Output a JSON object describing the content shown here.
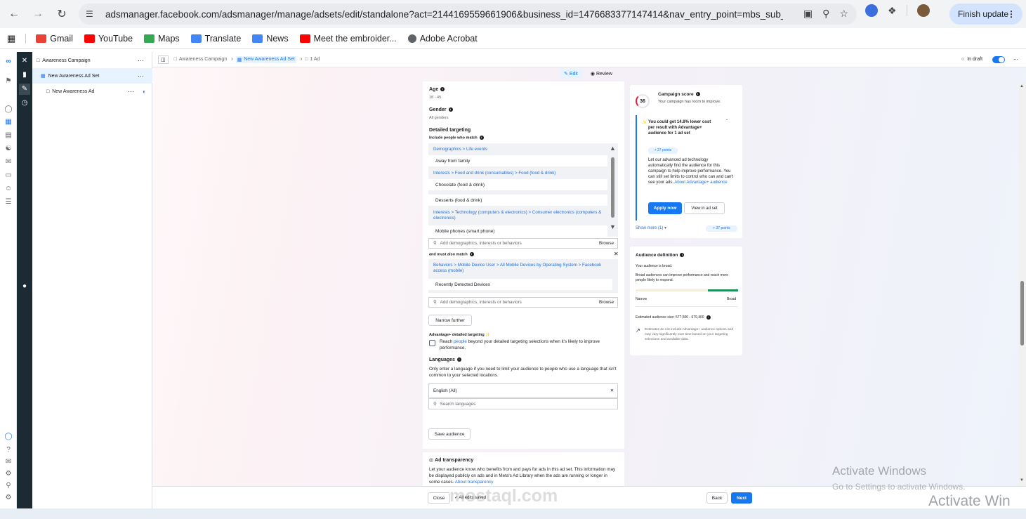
{
  "browser": {
    "url": "adsmanager.facebook.com/adsmanager/manage/adsets/edit/standalone?act=2144169559661906&business_id=1476683377147414&nav_entry_point=mbs_sub_n...",
    "finish_update": "Finish update"
  },
  "bookmarks": [
    {
      "label": "Gmail",
      "icon": "gmail-icon",
      "color": "#ea4335"
    },
    {
      "label": "YouTube",
      "icon": "youtube-icon",
      "color": "#ff0000"
    },
    {
      "label": "Maps",
      "icon": "maps-icon",
      "color": "#34a853"
    },
    {
      "label": "Translate",
      "icon": "translate-icon",
      "color": "#4285f4"
    },
    {
      "label": "News",
      "icon": "news-icon",
      "color": "#4285f4"
    },
    {
      "label": "Meet the embroider...",
      "icon": "youtube-icon",
      "color": "#ff0000"
    },
    {
      "label": "Adobe Acrobat",
      "icon": "globe-icon",
      "color": "#5f6368"
    }
  ],
  "tree": {
    "campaign": "Awareness Campaign",
    "adset": "New Awareness Ad Set",
    "ad": "New Awareness Ad"
  },
  "breadcrumb": {
    "campaign": "Awareness Campaign",
    "adset": "New Awareness Ad Set",
    "ad": "1 Ad"
  },
  "status": {
    "draft": "In draft"
  },
  "tabs": {
    "edit": "Edit",
    "review": "Review"
  },
  "form": {
    "age_label": "Age",
    "age_value": "18 - 45",
    "gender_label": "Gender",
    "gender_value": "All genders",
    "detailed_label": "Detailed targeting",
    "include_label": "Include people who match",
    "targeting": [
      {
        "category": "Demographics > Life events",
        "items": [
          "Away from family"
        ]
      },
      {
        "category": "Interests > Food and drink (consumables) > Food (food & drink)",
        "items": [
          "Chocolate (food & drink)",
          "Desserts (food & drink)"
        ]
      },
      {
        "category": "Interests > Technology (computers & electronics) > Consumer electronics (computers & electronics)",
        "items": [
          "Mobile phones (smart phone)"
        ]
      }
    ],
    "search_placeholder": "Add demographics, interests or behaviors",
    "browse": "Browse",
    "must_match_label": "and must also match",
    "must_match": {
      "category": "Behaviors > Mobile Device User > All Mobile Devices by Operating System > Facebook access (mobile)",
      "item": "Recently Detected Devices"
    },
    "narrow_further": "Narrow further",
    "advantage_label": "Advantage+ detailed targeting",
    "advantage_desc_1": "Reach",
    "advantage_desc_link": "people",
    "advantage_desc_2": "beyond your detailed targeting selections when it's likely to improve performance.",
    "languages_label": "Languages",
    "languages_desc": "Only enter a language if you need to limit your audience to people who use a language that isn't common to your selected locations.",
    "language_selected": "English (All)",
    "language_search": "Search languages",
    "save_audience": "Save audience",
    "transparency_label": "Ad transparency",
    "transparency_desc": "Let your audience know who benefits from and pays for ads in this ad set. This information may be displayed publicly on ads and in Meta's Ad Library when the ads are running or longer in some cases.",
    "transparency_link": "About transparency"
  },
  "score": {
    "title": "Campaign score",
    "value": "36",
    "subtitle": "Your campaign has room to improve.",
    "tip_title": "You could get 14.8% lower cost per result with Advantage+ audience for 1 ad set",
    "points": "+ 27 points",
    "tip_desc": "Let our advanced ad technology automatically find the audience for this campaign to help improve performance. You can still set limits to control who can and can't see your ads.",
    "tip_link": "About Advantage+ audience",
    "apply_now": "Apply now",
    "view_in_adset": "View in ad set",
    "show_more": "Show more (1)",
    "total_points": "+ 37 points"
  },
  "audience": {
    "title": "Audience definition",
    "status": "Your audience is broad.",
    "desc": "Broad audiences can improve performance and reach more people likely to respond.",
    "narrow": "Narrow",
    "broad": "Broad",
    "size": "Estimated audience size: 577,500 - 679,400",
    "note": "Estimates do not include Advantage+ audience options and may vary significantly over time based on your targeting selections and available data.",
    "gauge_level": 0.85
  },
  "footer": {
    "close": "Close",
    "saved": "All edits saved",
    "back": "Back",
    "next": "Next"
  },
  "overlay": {
    "activate_title": "Activate Windows",
    "activate_sub": "Go to Settings to activate Windows.",
    "activate_big": "Activate Win",
    "watermark": "mostaql.com"
  },
  "colors": {
    "accent": "#1877f2",
    "dark": "#1c2b33",
    "score_red": "#e41e3f",
    "gauge_green": "#1a8f5a"
  }
}
